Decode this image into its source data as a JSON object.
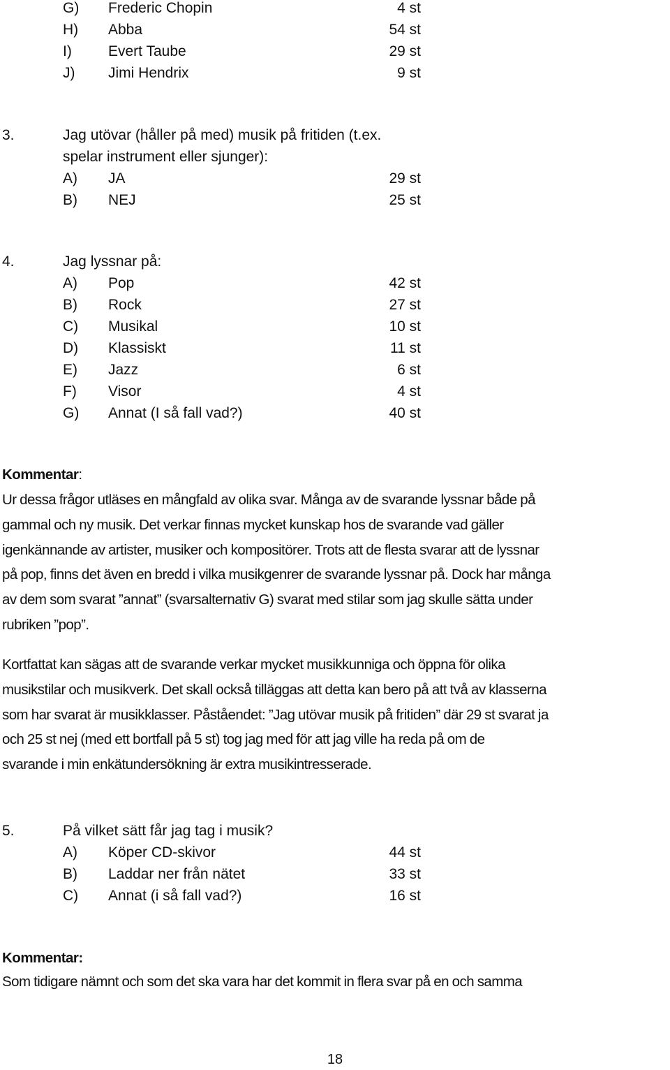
{
  "q2_continued": {
    "options": [
      {
        "letter": "G)",
        "label": "Frederic Chopin",
        "count": "4 st"
      },
      {
        "letter": "H)",
        "label": "Abba",
        "count": "54 st"
      },
      {
        "letter": "I)",
        "label": "Evert Taube",
        "count": "29 st"
      },
      {
        "letter": "J)",
        "label": "Jimi Hendrix",
        "count": "9 st"
      }
    ]
  },
  "q3": {
    "number": "3.",
    "text_line1": "Jag utövar (håller på med) musik på fritiden (t.ex.",
    "text_line2": "spelar instrument eller sjunger):",
    "options": [
      {
        "letter": "A)",
        "label": "JA",
        "count": "29 st"
      },
      {
        "letter": "B)",
        "label": "NEJ",
        "count": "25 st"
      }
    ]
  },
  "q4": {
    "number": "4.",
    "text": "Jag lyssnar på:",
    "options": [
      {
        "letter": "A)",
        "label": "Pop",
        "count": "42 st"
      },
      {
        "letter": "B)",
        "label": "Rock",
        "count": "27 st"
      },
      {
        "letter": "C)",
        "label": "Musikal",
        "count": "10 st"
      },
      {
        "letter": "D)",
        "label": "Klassiskt",
        "count": "11 st"
      },
      {
        "letter": "E)",
        "label": "Jazz",
        "count": "6 st"
      },
      {
        "letter": "F)",
        "label": "Visor",
        "count": "4 st"
      },
      {
        "letter": "G)",
        "label": "Annat (I så fall vad?)",
        "count": "40 st"
      }
    ]
  },
  "comment1": {
    "heading_bold": "Kommentar",
    "heading_colon": ":",
    "paragraph1_lines": [
      "Ur dessa frågor utläses en mångfald av olika svar. Många av de svarande lyssnar både på",
      "gammal och ny musik. Det verkar finnas mycket kunskap hos de svarande vad gäller",
      "igenkännande av artister, musiker och kompositörer. Trots att de flesta svarar att de lyssnar",
      "på pop, finns det även en bredd i vilka musikgenrer de svarande lyssnar på. Dock har många",
      "av dem som svarat ”annat” (svarsalternativ G) svarat med stilar som jag skulle sätta under",
      "rubriken ”pop”."
    ],
    "paragraph2_lines": [
      "Kortfattat kan sägas att de svarande verkar mycket musikkunniga och öppna för olika",
      "musikstilar och musikverk. Det skall också tilläggas att detta kan bero på att två av klasserna",
      "som har svarat är musikklasser. Påståendet: ”Jag utövar musik på fritiden” där 29 st svarat ja",
      "och 25 st nej (med ett bortfall på 5 st) tog jag med för att jag ville ha reda på om de",
      "svarande i min enkätundersökning är extra musikintresserade."
    ]
  },
  "q5": {
    "number": "5.",
    "text": "På vilket sätt får jag tag i musik?",
    "options": [
      {
        "letter": "A)",
        "label": "Köper CD-skivor",
        "count": "44 st"
      },
      {
        "letter": "B)",
        "label": "Laddar ner från nätet",
        "count": "33 st"
      },
      {
        "letter": "C)",
        "label": "Annat (i så fall vad?)",
        "count": "16 st"
      }
    ]
  },
  "comment2": {
    "heading": "Kommentar:",
    "line1": "Som tidigare nämnt och som det ska vara har det kommit in flera svar på en och samma"
  },
  "page_number": "18"
}
